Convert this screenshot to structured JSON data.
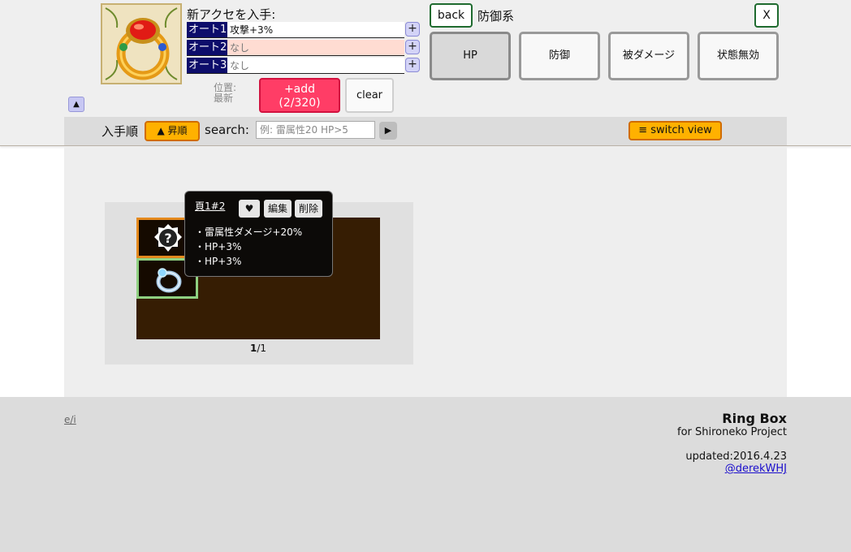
{
  "header": {
    "new_accessory_title": "新アクセを入手:",
    "auto_slots": [
      {
        "label": "オート1",
        "value": "攻撃+3%"
      },
      {
        "label": "オート2",
        "value": "なし"
      },
      {
        "label": "オート3",
        "value": "なし"
      }
    ],
    "plus_label": "+",
    "position_label": "位置:",
    "position_value": "最新",
    "add_button": {
      "label": "+add",
      "count": "(2/320)"
    },
    "clear_button": "clear",
    "collapse_icon": "▲"
  },
  "category_panel": {
    "back_button": "back",
    "title": "防御系",
    "close_button": "X",
    "buttons": [
      "HP",
      "防御",
      "被ダメージ",
      "状態無効"
    ],
    "active": "HP"
  },
  "toolbar": {
    "sort_label": "入手順",
    "order_button": "▲ 昇順",
    "search_label": "search:",
    "search_placeholder": "例: 雷属性20 HP>5",
    "search_value": "",
    "play_icon": "▶",
    "switch_view_button": "≡ switch view"
  },
  "ring_box": {
    "slots": [
      {
        "icon": "unknown-accessory-icon",
        "selected": false
      },
      {
        "icon": "silver-ring-icon",
        "selected": true
      }
    ],
    "page_current": "1",
    "page_total": "/1"
  },
  "tooltip": {
    "id": "頁1#2",
    "favorite_icon": "♥",
    "edit_button": "編集",
    "delete_button": "削除",
    "lines": [
      "・雷属性ダメージ+20%",
      "・HP+3%",
      "・HP+3%"
    ]
  },
  "footer": {
    "lang_link": "e/i",
    "app_title": "Ring Box",
    "subtitle": "for Shironeko Project",
    "updated": "updated:2016.4.23",
    "author": "@derekWHJ"
  },
  "colors": {
    "auto_label_bg": "#0d0d6b",
    "add_button_bg": "#ff3d66",
    "orange_button_bg": "#ffb100",
    "box_bg": "#361d03",
    "slot_border": "#e4891d",
    "selected_slot_border": "#8fd081"
  }
}
